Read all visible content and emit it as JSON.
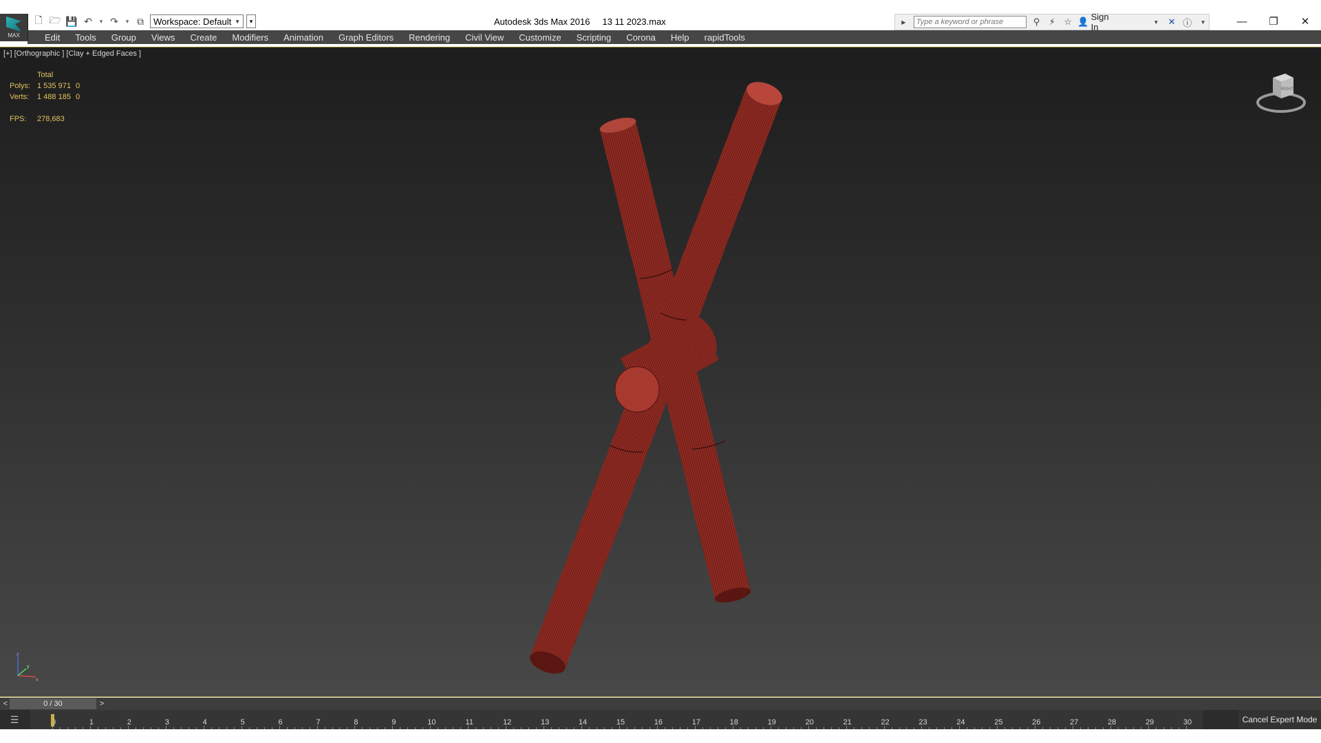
{
  "app": {
    "logo_text": "MAX",
    "title": "Autodesk 3ds Max 2016     13 11 2023.max"
  },
  "quick_access": {
    "workspace_label": "Workspace: Default"
  },
  "search": {
    "placeholder": "Type a keyword or phrase",
    "sign_in_label": "Sign In"
  },
  "menu": {
    "items": [
      "Edit",
      "Tools",
      "Group",
      "Views",
      "Create",
      "Modifiers",
      "Animation",
      "Graph Editors",
      "Rendering",
      "Civil View",
      "Customize",
      "Scripting",
      "Corona",
      "Help",
      "rapidTools"
    ]
  },
  "viewport": {
    "label": "[+] [Orthographic ] [Clay + Edged Faces ]",
    "stats": {
      "header": "Total",
      "polys_label": "Polys:",
      "polys_value": "1 535 971",
      "polys_sel": "0",
      "verts_label": "Verts:",
      "verts_value": "1 488 185",
      "verts_sel": "0",
      "fps_label": "FPS:",
      "fps_value": "278,683"
    },
    "viewcube_label": "RIGHT",
    "axis_labels": {
      "z": "z",
      "x": "x",
      "y": "y"
    },
    "object_color": "#8e2a22"
  },
  "time_slider": {
    "prev": "<",
    "next": ">",
    "position": "0 / 30",
    "current_frame": 0,
    "total_frames": 30
  },
  "trackbar": {
    "ticks": [
      "0",
      "1",
      "2",
      "3",
      "4",
      "5",
      "6",
      "7",
      "8",
      "9",
      "10",
      "11",
      "12",
      "13",
      "14",
      "15",
      "16",
      "17",
      "18",
      "19",
      "20",
      "21",
      "22",
      "23",
      "24",
      "25",
      "26",
      "27",
      "28",
      "29",
      "30"
    ],
    "cancel_expert_label": "Cancel Expert Mode"
  },
  "colors": {
    "menubar_bg": "#464646",
    "stats_text": "#e3c35e",
    "viewport_border": "#8d7a2a"
  }
}
